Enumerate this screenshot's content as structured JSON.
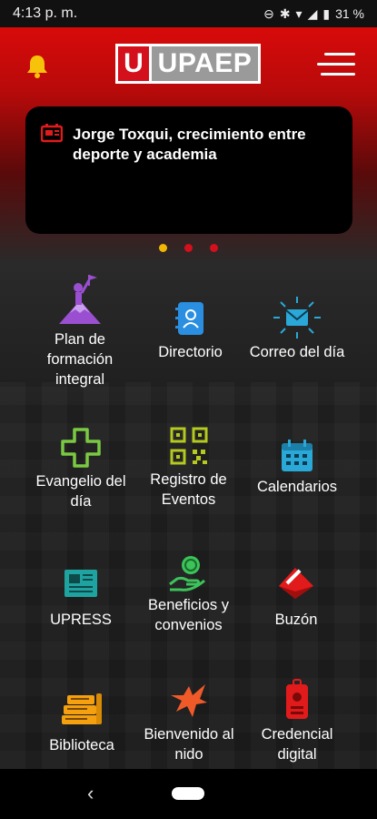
{
  "status": {
    "time": "4:13 p. m.",
    "battery": "31 %"
  },
  "header": {
    "logo_u": "U",
    "logo_text": "UPAEP"
  },
  "news": {
    "title": "Jorge Toxqui, crecimiento entre deporte y academia"
  },
  "colors": {
    "brand_red": "#d3101c",
    "active_dot": "#f2b705"
  },
  "grid": {
    "items": [
      {
        "label": "Plan de formación integral",
        "icon": "person-summit-flag-icon"
      },
      {
        "label": "Directorio",
        "icon": "contacts-book-icon"
      },
      {
        "label": "Correo del día",
        "icon": "mail-burst-icon"
      },
      {
        "label": "Evangelio del día",
        "icon": "cross-icon"
      },
      {
        "label": "Registro de Eventos",
        "icon": "qr-code-icon"
      },
      {
        "label": "Calendarios",
        "icon": "calendar-icon"
      },
      {
        "label": "UPRESS",
        "icon": "newspaper-icon"
      },
      {
        "label": "Beneficios y convenios",
        "icon": "hand-coin-icon"
      },
      {
        "label": "Buzón",
        "icon": "mailbox-icon"
      },
      {
        "label": "Biblioteca",
        "icon": "books-icon"
      },
      {
        "label": "Bienvenido al nido",
        "icon": "eagle-icon"
      },
      {
        "label": "Credencial digital",
        "icon": "id-badge-icon"
      }
    ]
  }
}
